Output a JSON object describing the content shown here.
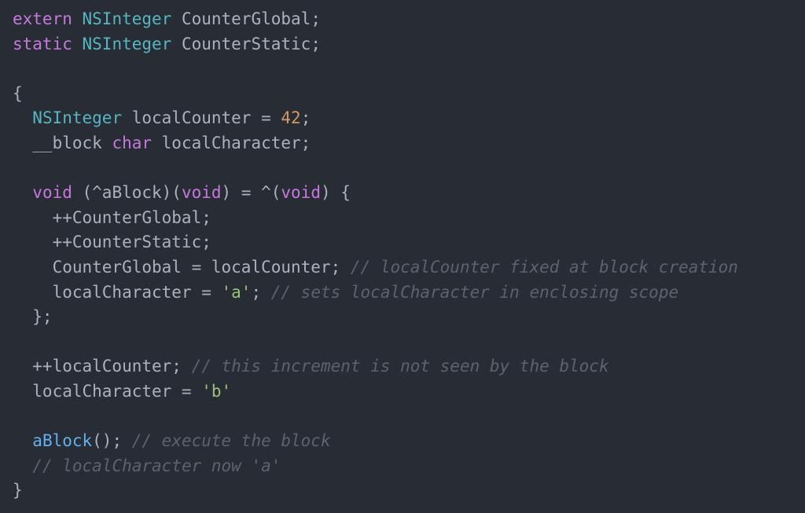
{
  "editor": {
    "colors": {
      "background": "#282c34",
      "plain": "#abb2bf",
      "keyword": "#c678dd",
      "type": "#56b6c2",
      "number": "#d19a66",
      "string": "#98c379",
      "function": "#61afef",
      "comment": "#5c6370"
    },
    "lines": [
      [
        {
          "t": "keyword",
          "v": "extern"
        },
        {
          "t": "plain",
          "v": " "
        },
        {
          "t": "type",
          "v": "NSInteger"
        },
        {
          "t": "plain",
          "v": " CounterGlobal;"
        }
      ],
      [
        {
          "t": "keyword",
          "v": "static"
        },
        {
          "t": "plain",
          "v": " "
        },
        {
          "t": "type",
          "v": "NSInteger"
        },
        {
          "t": "plain",
          "v": " CounterStatic;"
        }
      ],
      [],
      [
        {
          "t": "plain",
          "v": "{"
        }
      ],
      [
        {
          "t": "plain",
          "v": "  "
        },
        {
          "t": "type",
          "v": "NSInteger"
        },
        {
          "t": "plain",
          "v": " localCounter = "
        },
        {
          "t": "number",
          "v": "42"
        },
        {
          "t": "plain",
          "v": ";"
        }
      ],
      [
        {
          "t": "plain",
          "v": "  __block "
        },
        {
          "t": "keyword",
          "v": "char"
        },
        {
          "t": "plain",
          "v": " localCharacter;"
        }
      ],
      [],
      [
        {
          "t": "plain",
          "v": "  "
        },
        {
          "t": "keyword",
          "v": "void"
        },
        {
          "t": "plain",
          "v": " (^aBlock)("
        },
        {
          "t": "keyword",
          "v": "void"
        },
        {
          "t": "plain",
          "v": ") = ^("
        },
        {
          "t": "keyword",
          "v": "void"
        },
        {
          "t": "plain",
          "v": ") {"
        }
      ],
      [
        {
          "t": "plain",
          "v": "    ++CounterGlobal;"
        }
      ],
      [
        {
          "t": "plain",
          "v": "    ++CounterStatic;"
        }
      ],
      [
        {
          "t": "plain",
          "v": "    CounterGlobal = localCounter; "
        },
        {
          "t": "comment",
          "v": "// localCounter fixed at block creation"
        }
      ],
      [
        {
          "t": "plain",
          "v": "    localCharacter = "
        },
        {
          "t": "string",
          "v": "'a'"
        },
        {
          "t": "plain",
          "v": "; "
        },
        {
          "t": "comment",
          "v": "// sets localCharacter in enclosing scope"
        }
      ],
      [
        {
          "t": "plain",
          "v": "  };"
        }
      ],
      [],
      [
        {
          "t": "plain",
          "v": "  ++localCounter; "
        },
        {
          "t": "comment",
          "v": "// this increment is not seen by the block"
        }
      ],
      [
        {
          "t": "plain",
          "v": "  localCharacter = "
        },
        {
          "t": "string",
          "v": "'b'"
        }
      ],
      [],
      [
        {
          "t": "plain",
          "v": "  "
        },
        {
          "t": "function",
          "v": "aBlock"
        },
        {
          "t": "plain",
          "v": "(); "
        },
        {
          "t": "comment",
          "v": "// execute the block"
        }
      ],
      [
        {
          "t": "plain",
          "v": "  "
        },
        {
          "t": "comment",
          "v": "// localCharacter now 'a'"
        }
      ],
      [
        {
          "t": "plain",
          "v": "}"
        }
      ]
    ]
  }
}
